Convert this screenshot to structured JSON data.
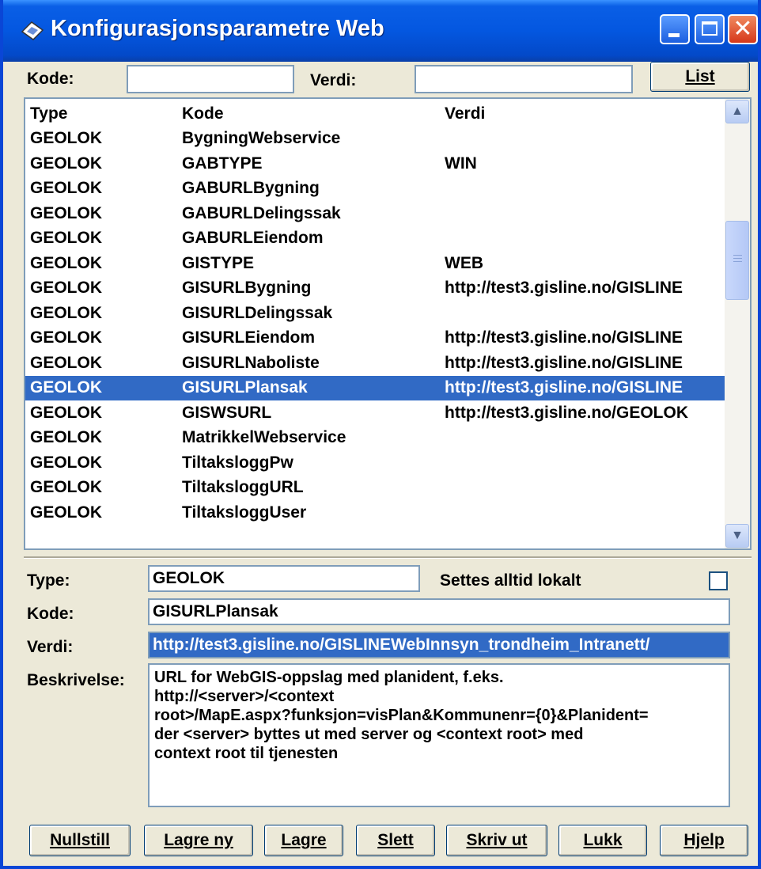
{
  "window": {
    "title": "Konfigurasjonsparametre Web"
  },
  "filter": {
    "kode_label": "Kode:",
    "kode_value": "",
    "verdi_label": "Verdi:",
    "verdi_value": "",
    "list_button": "List"
  },
  "list": {
    "columns": [
      "Type",
      "Kode",
      "Verdi"
    ],
    "selected_index": 10,
    "rows": [
      {
        "type": "GEOLOK",
        "kode": "BygningWebservice",
        "verdi": ""
      },
      {
        "type": "GEOLOK",
        "kode": "GABTYPE",
        "verdi": "WIN"
      },
      {
        "type": "GEOLOK",
        "kode": "GABURLBygning",
        "verdi": ""
      },
      {
        "type": "GEOLOK",
        "kode": "GABURLDelingssak",
        "verdi": ""
      },
      {
        "type": "GEOLOK",
        "kode": "GABURLEiendom",
        "verdi": ""
      },
      {
        "type": "GEOLOK",
        "kode": "GISTYPE",
        "verdi": "WEB"
      },
      {
        "type": "GEOLOK",
        "kode": "GISURLBygning",
        "verdi": "http://test3.gisline.no/GISLINE"
      },
      {
        "type": "GEOLOK",
        "kode": "GISURLDelingssak",
        "verdi": ""
      },
      {
        "type": "GEOLOK",
        "kode": "GISURLEiendom",
        "verdi": "http://test3.gisline.no/GISLINE"
      },
      {
        "type": "GEOLOK",
        "kode": "GISURLNaboliste",
        "verdi": "http://test3.gisline.no/GISLINE"
      },
      {
        "type": "GEOLOK",
        "kode": "GISURLPlansak",
        "verdi": "http://test3.gisline.no/GISLINE"
      },
      {
        "type": "GEOLOK",
        "kode": "GISWSURL",
        "verdi": "http://test3.gisline.no/GEOLOK"
      },
      {
        "type": "GEOLOK",
        "kode": "MatrikkelWebservice",
        "verdi": ""
      },
      {
        "type": "GEOLOK",
        "kode": "TiltaksloggPw",
        "verdi": ""
      },
      {
        "type": "GEOLOK",
        "kode": "TiltaksloggURL",
        "verdi": ""
      },
      {
        "type": "GEOLOK",
        "kode": "TiltaksloggUser",
        "verdi": ""
      }
    ]
  },
  "detail": {
    "type_label": "Type:",
    "type_value": "GEOLOK",
    "lokalt_label": "Settes alltid lokalt",
    "lokalt_checked": false,
    "kode_label": "Kode:",
    "kode_value": "GISURLPlansak",
    "verdi_label": "Verdi:",
    "verdi_value": "http://test3.gisline.no/GISLINEWebInnsyn_trondheim_Intranett/",
    "beskrivelse_label": "Beskrivelse:",
    "beskrivelse_value": "URL for WebGIS-oppslag med planident, f.eks.\nhttp://<server>/<context\nroot>/MapE.aspx?funksjon=visPlan&Kommunenr={0}&Planident=\nder <server> byttes ut med server og <context root> med\ncontext root til tjenesten"
  },
  "buttons": {
    "nullstill": "Nullstill",
    "lagre_ny": "Lagre ny",
    "lagre": "Lagre",
    "slett": "Slett",
    "skriv_ut": "Skriv ut",
    "lukk": "Lukk",
    "hjelp": "Hjelp"
  },
  "colors": {
    "titlebar": "#0457e0",
    "selection": "#316ac5",
    "face": "#ece9d8"
  }
}
